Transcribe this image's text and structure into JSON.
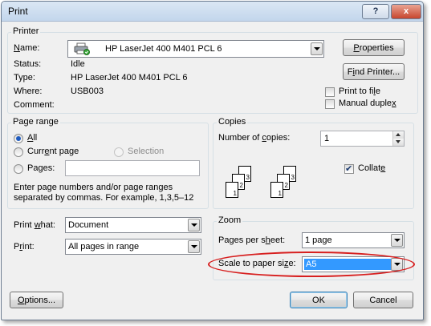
{
  "window": {
    "title": "Print",
    "help_label": "?",
    "close_label": "x"
  },
  "printer": {
    "group_label": "Printer",
    "name_label": "Name:",
    "name_value": "HP LaserJet 400 M401 PCL 6",
    "status_label": "Status:",
    "status_value": "Idle",
    "type_label": "Type:",
    "type_value": "HP LaserJet 400 M401 PCL 6",
    "where_label": "Where:",
    "where_value": "USB003",
    "comment_label": "Comment:",
    "comment_value": "",
    "properties_button": "Properties",
    "find_printer_button": "Find Printer...",
    "print_to_file_label": "Print to file",
    "print_to_file_checked": false,
    "manual_duplex_label": "Manual duplex",
    "manual_duplex_checked": false
  },
  "page_range": {
    "group_label": "Page range",
    "all_label": "All",
    "all_selected": true,
    "current_page_label": "Current page",
    "selection_label": "Selection",
    "pages_label": "Pages:",
    "pages_value": "",
    "help_line1": "Enter page numbers and/or page ranges",
    "help_line2": "separated by commas.  For example, 1,3,5–12"
  },
  "copies": {
    "group_label": "Copies",
    "number_label": "Number of copies:",
    "number_value": "1",
    "collate_label": "Collate",
    "collate_checked": true,
    "stack_pages": [
      "3",
      "2",
      "1"
    ]
  },
  "print_what": {
    "label": "Print what:",
    "value": "Document"
  },
  "print": {
    "label": "Print:",
    "value": "All pages in range"
  },
  "zoom": {
    "group_label": "Zoom",
    "pages_per_sheet_label": "Pages per sheet:",
    "pages_per_sheet_value": "1 page",
    "scale_label": "Scale to paper size:",
    "scale_value": "A5"
  },
  "footer": {
    "options_button": "Options...",
    "ok_button": "OK",
    "cancel_button": "Cancel"
  },
  "colors": {
    "highlight_ring": "#d71f1f",
    "selection_blue": "#3399ff"
  }
}
